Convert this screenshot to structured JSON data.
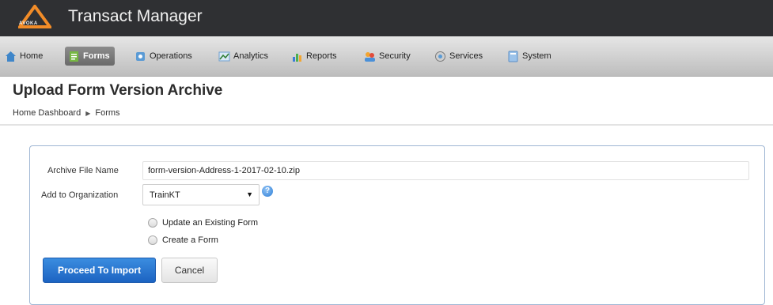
{
  "header": {
    "logo_text": "AVOKA",
    "app_title": "Transact Manager"
  },
  "nav": {
    "items": [
      {
        "label": "Home",
        "icon": "home-icon",
        "active": false
      },
      {
        "label": "Forms",
        "icon": "forms-icon",
        "active": true
      },
      {
        "label": "Operations",
        "icon": "operations-icon",
        "active": false
      },
      {
        "label": "Analytics",
        "icon": "analytics-icon",
        "active": false
      },
      {
        "label": "Reports",
        "icon": "reports-icon",
        "active": false
      },
      {
        "label": "Security",
        "icon": "security-icon",
        "active": false
      },
      {
        "label": "Services",
        "icon": "services-icon",
        "active": false
      },
      {
        "label": "System",
        "icon": "system-icon",
        "active": false
      }
    ]
  },
  "page": {
    "title": "Upload Form Version Archive",
    "breadcrumb": [
      "Home Dashboard",
      "Forms"
    ]
  },
  "form": {
    "archive_label": "Archive File Name",
    "archive_value": "form-version-Address-1-2017-02-10.zip",
    "org_label": "Add to Organization",
    "org_selected": "TrainKT",
    "radio_options": [
      "Update an Existing Form",
      "Create a Form"
    ],
    "proceed_label": "Proceed To Import",
    "cancel_label": "Cancel"
  },
  "colors": {
    "header_bg": "#2f3033",
    "accent": "#f28c28",
    "primary_button": "#1c63c2"
  }
}
